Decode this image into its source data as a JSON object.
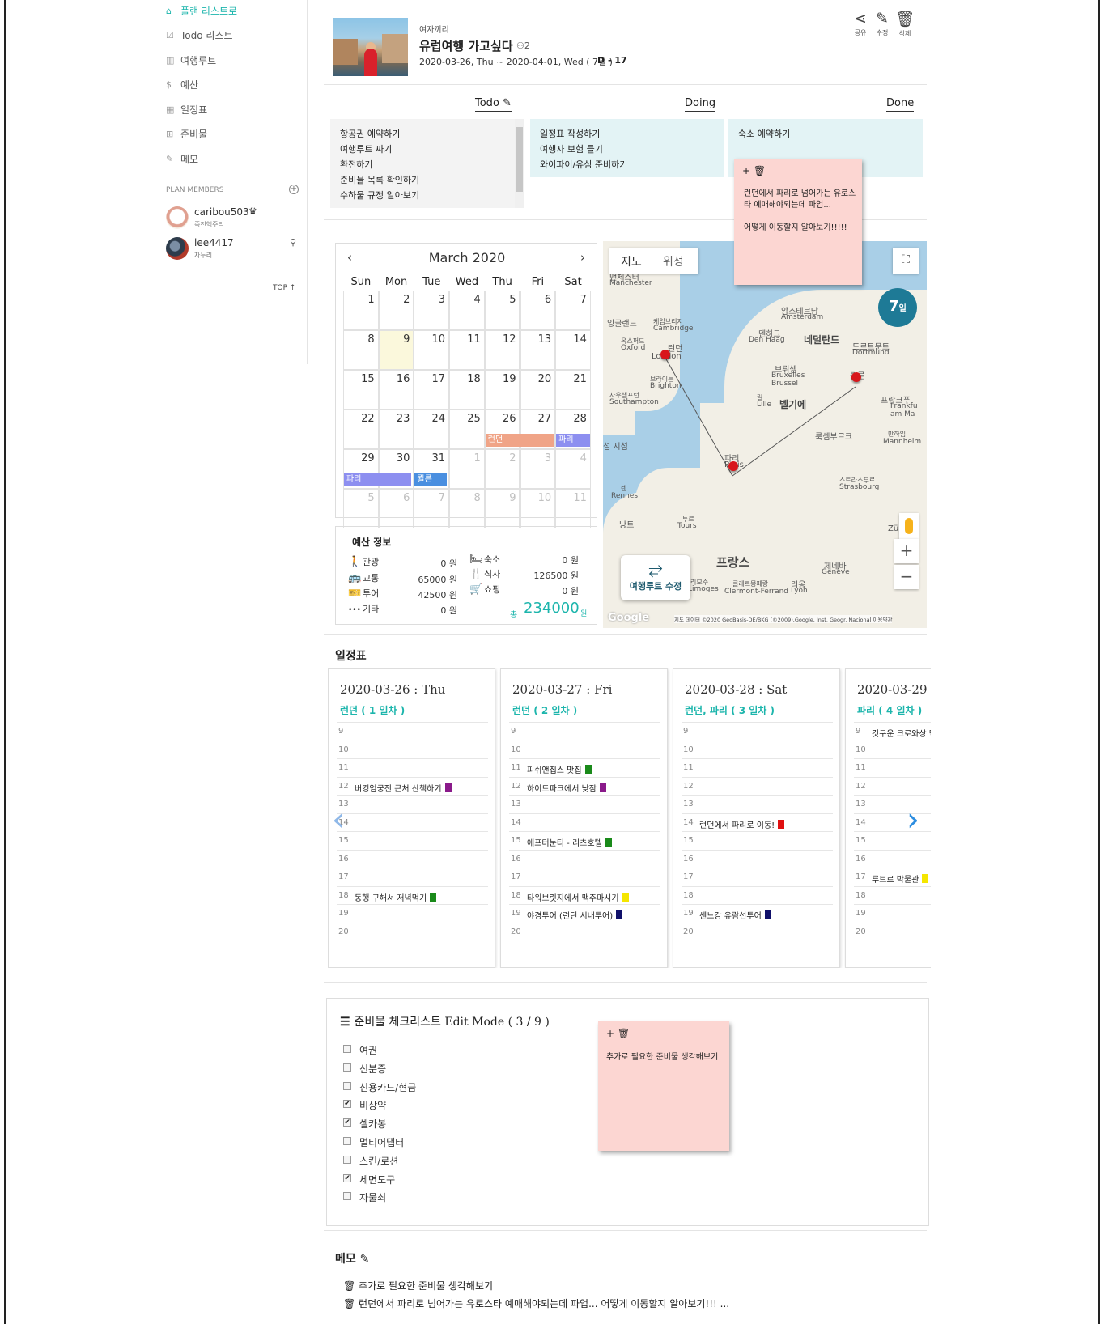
{
  "sidebar": {
    "items": [
      {
        "icon": "home-icon",
        "glyph": "⌂",
        "label": "플랜 리스트로"
      },
      {
        "icon": "checkbox-icon",
        "glyph": "☑",
        "label": "Todo 리스트"
      },
      {
        "icon": "map-icon",
        "glyph": "▥",
        "label": "여행루트"
      },
      {
        "icon": "dollar-icon",
        "glyph": "$",
        "label": "예산"
      },
      {
        "icon": "calendar-icon",
        "glyph": "▦",
        "label": "일정표"
      },
      {
        "icon": "suitcase-icon",
        "glyph": "⊞",
        "label": "준비물"
      },
      {
        "icon": "pencil-icon",
        "glyph": "✎",
        "label": "메모"
      }
    ],
    "members_title": "PLAN MEMBERS",
    "add_member": "+",
    "members": [
      {
        "name": "caribou503",
        "role": "죽전핵주먹",
        "crown": "♛",
        "color": "#e9b0a4"
      },
      {
        "name": "lee4417",
        "role": "차두리",
        "icon": "remove-member-icon",
        "color": "#3c4a5a"
      }
    ],
    "top_link": "TOP ↑"
  },
  "plan": {
    "group": "여자끼리",
    "title": "유럽여행 가고싶다",
    "members_count": "2",
    "dates": "2020-03-26, Thu ~ 2020-04-01, Wed ( 7일 )",
    "dday": "D - 17",
    "actions": [
      {
        "icon": "share-icon",
        "glyph": "⋖",
        "label": "공유"
      },
      {
        "icon": "edit-icon",
        "glyph": "✎",
        "label": "수정"
      },
      {
        "icon": "trash-icon",
        "glyph": "🗑",
        "label": "삭제"
      }
    ]
  },
  "kanban": {
    "todo_title": "Todo ✎",
    "doing_title": "Doing",
    "done_title": "Done",
    "todo": [
      "항공권 예약하기",
      "여행루트 짜기",
      "환전하기",
      "준비물 목록 확인하기",
      "수하물 규정 알아보기"
    ],
    "doing": [
      "일정표 작성하기",
      "여행자 보험 들기",
      "와이파이/유심 준비하기"
    ],
    "done": [
      "숙소 예약하기"
    ]
  },
  "sticky_top": {
    "tools": "+ 🗑",
    "lines": [
      "런던에서 파리로 넘어가는 유로스",
      "타 예매해야되는데 파업...",
      "",
      "어떻게 이동할지 알아보기!!!!!"
    ]
  },
  "calendar": {
    "month": "March 2020",
    "prev": "‹",
    "next": "›",
    "dow": [
      "Sun",
      "Mon",
      "Tue",
      "Wed",
      "Thu",
      "Fri",
      "Sat"
    ],
    "weeks": [
      [
        "1",
        "2",
        "3",
        "4",
        "5",
        "6",
        "7"
      ],
      [
        "8",
        "9",
        "10",
        "11",
        "12",
        "13",
        "14"
      ],
      [
        "15",
        "16",
        "17",
        "18",
        "19",
        "20",
        "21"
      ],
      [
        "22",
        "23",
        "24",
        "25",
        "26",
        "27",
        "28"
      ],
      [
        "29",
        "30",
        "31",
        "1",
        "2",
        "3",
        "4"
      ],
      [
        "5",
        "6",
        "7",
        "8",
        "9",
        "10",
        "11"
      ]
    ],
    "events": [
      {
        "label": "런던",
        "color": "#f0a487"
      },
      {
        "label": "파리",
        "color": "#8d8ff0"
      },
      {
        "label": "파리",
        "color": "#8d8ff0"
      },
      {
        "label": "퀼른",
        "color": "#4a8fe0"
      }
    ]
  },
  "budget": {
    "title": "예산 정보",
    "rows": [
      {
        "icon": "walk-icon",
        "glyph": "🚶",
        "label": "관광",
        "value": "0 원"
      },
      {
        "icon": "bus-icon",
        "glyph": "🚌",
        "label": "교통",
        "value": "65000 원"
      },
      {
        "icon": "ticket-icon",
        "glyph": "🎫",
        "label": "투어",
        "value": "42500 원"
      },
      {
        "icon": "more-icon",
        "glyph": "•••",
        "label": "기타",
        "value": "0 원"
      },
      {
        "icon": "bed-icon",
        "glyph": "🛏",
        "label": "숙소",
        "value": "0 원"
      },
      {
        "icon": "fork-icon",
        "glyph": "🍴",
        "label": "식사",
        "value": "126500 원"
      },
      {
        "icon": "cart-icon",
        "glyph": "🛒",
        "label": "쇼핑",
        "value": "0 원"
      }
    ],
    "total_label": "총",
    "total": "234000",
    "total_unit": "원"
  },
  "map": {
    "tab_map": "지도",
    "tab_sat": "위성",
    "days": "7",
    "days_unit": "일",
    "route_label": "여행루트 수정",
    "zoom_in": "+",
    "zoom_out": "−",
    "google": "Google",
    "attribution": "지도 데이터 ©2020 GeoBasis-DE/BKG (©2009),Google, Inst. Geogr. Nacional  이용약관",
    "labels": {
      "manchester_ko": "맨체스터",
      "manchester": "Manchester",
      "england": "잉글랜드",
      "cambridge_ko": "케임브리지",
      "cambridge": "Cambridge",
      "oxford_ko": "옥스퍼드",
      "oxford": "Oxford",
      "london_ko": "런던",
      "london": "London",
      "brighton_ko": "브라이튼",
      "brighton": "Brighton",
      "southampton_ko": "사우샘프턴",
      "southampton": "Southampton",
      "amsterdam_ko": "암스테르담",
      "amsterdam": "Amsterdam",
      "denhaag_ko": "덴하그",
      "denhaag": "Den Haag",
      "netherlands": "네덜란드",
      "dortmund_ko": "도르트문트",
      "dortmund": "Dortmund",
      "brussels_ko": "브뤼셀",
      "brussels": "Bruxelles Brussel",
      "lille_ko": "릴",
      "lille": "Lille",
      "belgium": "벨기에",
      "cologne_ko": "쾰른",
      "frankfurt_ko": "프랑크푸",
      "frankfurt": "Frankfu am Ma",
      "luxembourg": "룩셈부르크",
      "mannheim_ko": "만하임",
      "mannheim": "Mannheim",
      "paris_ko": "파리",
      "paris": "Paris",
      "strasbourg_ko": "스트라스부르",
      "strasbourg": "Strasbourg",
      "rennes_ko": "렌",
      "rennes": "Rennes",
      "nantes_ko": "낭트",
      "tours_ko": "투르",
      "tours": "Tours",
      "france": "프랑스",
      "zurich": "Zürich",
      "geneva_ko": "제네바",
      "geneva": "Genève",
      "limoges_ko": "리모주",
      "limoges": "Limoges",
      "clermont_ko": "클레르몽페랑",
      "clermont": "Clermont-Ferrand",
      "lyon_ko": "리옹",
      "lyon": "Lyon",
      "channel_islands": "섬 지섬"
    }
  },
  "schedule": {
    "title": "일정표",
    "days": [
      {
        "date": "2020-03-26 : Thu",
        "loc": "런던  ( 1 일차 )",
        "slots": [
          [
            "9",
            ""
          ],
          [
            "10",
            ""
          ],
          [
            "11",
            ""
          ],
          [
            "12",
            "버킹엄궁전 근처 산책하기"
          ],
          [
            "13",
            ""
          ],
          [
            "14",
            ""
          ],
          [
            "15",
            ""
          ],
          [
            "16",
            ""
          ],
          [
            "17",
            ""
          ],
          [
            "18",
            "동행 구해서 저녁먹기"
          ],
          [
            "19",
            ""
          ],
          [
            "20",
            ""
          ]
        ],
        "tags": {
          "3": "#8a1a8a",
          "9": "#1a8a1a"
        }
      },
      {
        "date": "2020-03-27 : Fri",
        "loc": "런던  ( 2 일차 )",
        "slots": [
          [
            "9",
            ""
          ],
          [
            "10",
            ""
          ],
          [
            "11",
            "피쉬앤칩스 맛집"
          ],
          [
            "12",
            "하이드파크에서 낮잠"
          ],
          [
            "13",
            ""
          ],
          [
            "14",
            ""
          ],
          [
            "15",
            "애프터눈티 - 리츠호텔"
          ],
          [
            "16",
            ""
          ],
          [
            "17",
            ""
          ],
          [
            "18",
            "타워브릿지에서 맥주마시기"
          ],
          [
            "19",
            "야경투어 (런던 시내투어)"
          ],
          [
            "20",
            ""
          ]
        ],
        "tags": {
          "2": "#1a8a1a",
          "3": "#8a1a8a",
          "6": "#1a8a1a",
          "9": "#f5e600",
          "10": "#10106a"
        }
      },
      {
        "date": "2020-03-28 : Sat",
        "loc": "런던, 파리  ( 3 일차 )",
        "slots": [
          [
            "9",
            ""
          ],
          [
            "10",
            ""
          ],
          [
            "11",
            ""
          ],
          [
            "12",
            ""
          ],
          [
            "13",
            ""
          ],
          [
            "14",
            "런던에서 파리로 이동!"
          ],
          [
            "15",
            ""
          ],
          [
            "16",
            ""
          ],
          [
            "17",
            ""
          ],
          [
            "18",
            ""
          ],
          [
            "19",
            "센느강 유람선투어"
          ],
          [
            "20",
            ""
          ]
        ],
        "tags": {
          "5": "#e01010",
          "10": "#10106a"
        }
      },
      {
        "date": "2020-03-29",
        "loc": "파리  ( 4 일차 )",
        "slots": [
          [
            "9",
            "갓구운 크로와상 먹"
          ],
          [
            "10",
            ""
          ],
          [
            "11",
            ""
          ],
          [
            "12",
            ""
          ],
          [
            "13",
            ""
          ],
          [
            "14",
            ""
          ],
          [
            "15",
            ""
          ],
          [
            "16",
            ""
          ],
          [
            "17",
            "루브르 박물관"
          ],
          [
            "18",
            ""
          ],
          [
            "19",
            ""
          ],
          [
            "20",
            ""
          ]
        ],
        "tags": {
          "8": "#f5e600"
        }
      }
    ],
    "prev": "‹",
    "next": "›"
  },
  "checklist": {
    "title": "준비물 체크리스트   Edit Mode   ( 3 / 9 )",
    "items": [
      {
        "label": "여권",
        "checked": false
      },
      {
        "label": "신분증",
        "checked": false
      },
      {
        "label": "신용카드/현금",
        "checked": false
      },
      {
        "label": "비상약",
        "checked": true
      },
      {
        "label": "셀카봉",
        "checked": true
      },
      {
        "label": "멀티어댑터",
        "checked": false
      },
      {
        "label": "스킨/로션",
        "checked": false
      },
      {
        "label": "세면도구",
        "checked": true
      },
      {
        "label": "자물쇠",
        "checked": false
      }
    ],
    "check_mark": "✔"
  },
  "sticky_check": {
    "tools": "+ 🗑",
    "line": "추가로 필요한 준비물 생각해보기"
  },
  "memo": {
    "title": "메모 ✎",
    "lines": [
      "🗑 추가로 필요한 준비물 생각해보기",
      "🗑 런던에서 파리로 넘어가는 유로스타 예매해야되는데 파업... 어떻게 이동할지 알아보기!!! ..."
    ]
  }
}
